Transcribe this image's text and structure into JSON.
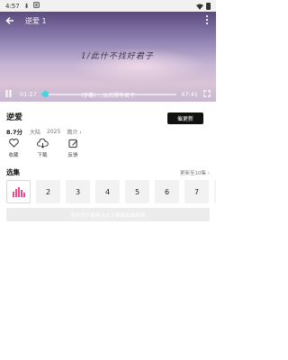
{
  "status_bar": {
    "time": "4:57",
    "icons": [
      "download-icon",
      "privacy-icon"
    ]
  },
  "player": {
    "title": "逆爱 1",
    "handwriting_text": "1/此什不找好君子",
    "subtitle": "(字幕)  ...以后得有君子",
    "current_time": "01:27",
    "duration": "47:41",
    "progress_fraction": 0.03,
    "progress_color": "#3fd7e0"
  },
  "show": {
    "title": "逆爱",
    "score": "8.7分",
    "region": "大陆",
    "year": "2025",
    "intro_label": "简介 ›",
    "update_button": "催更新"
  },
  "actions": [
    {
      "icon": "heart-icon",
      "label": "收藏"
    },
    {
      "icon": "download-icon",
      "label": "下载"
    },
    {
      "icon": "feedback-icon",
      "label": "反馈"
    }
  ],
  "episodes_section": {
    "title": "选集",
    "more_label": "更新至10集 ›",
    "items": [
      "playing",
      "2",
      "3",
      "4",
      "5",
      "6",
      "7"
    ],
    "accent": "#e94b8c"
  },
  "notice": "若失效不能看点击下载最新破解版"
}
